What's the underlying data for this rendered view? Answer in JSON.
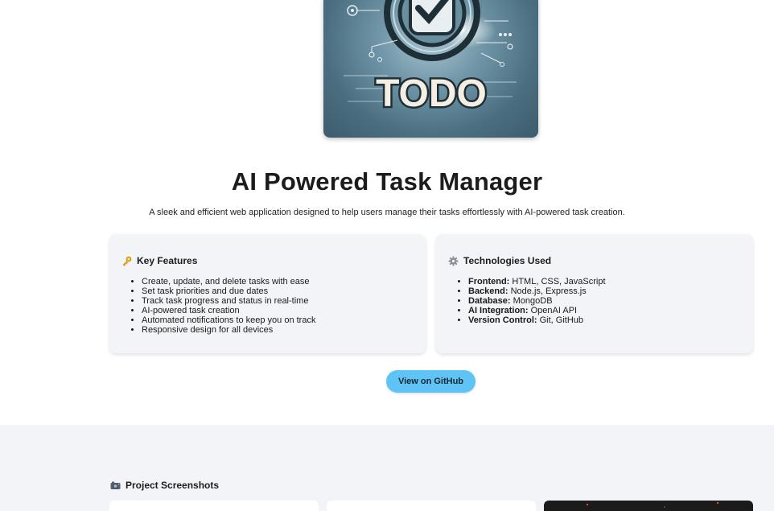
{
  "hero": {
    "logo_text": "TODO",
    "logo_colors": {
      "bg": "#4a6e80",
      "glow": "#ffffff",
      "text": "#f4efe2"
    }
  },
  "header": {
    "title": "AI Powered Task Manager",
    "subtitle": "A sleek and efficient web application designed to help users manage their tasks effortlessly with AI-powered task creation."
  },
  "features": {
    "icon": "key-icon",
    "title": "Key Features",
    "items": [
      "Create, update, and delete tasks with ease",
      "Set task priorities and due dates",
      "Track task progress and status in real-time",
      "AI-powered task creation",
      "Automated notifications to keep you on track",
      "Responsive design for all devices"
    ]
  },
  "technologies": {
    "icon": "gear-icon",
    "title": "Technologies Used",
    "items": [
      {
        "label": "Frontend:",
        "value": " HTML, CSS, JavaScript"
      },
      {
        "label": "Backend:",
        "value": " Node.js, Express.js"
      },
      {
        "label": "Database:",
        "value": " MongoDB"
      },
      {
        "label": "AI Integration:",
        "value": " OpenAI API"
      },
      {
        "label": "Version Control:",
        "value": " Git, GitHub"
      }
    ]
  },
  "cta": {
    "github_label": "View on GitHub",
    "color": "#5ec4f5"
  },
  "screenshots": {
    "icon": "camera-icon",
    "title": "Project Screenshots"
  }
}
